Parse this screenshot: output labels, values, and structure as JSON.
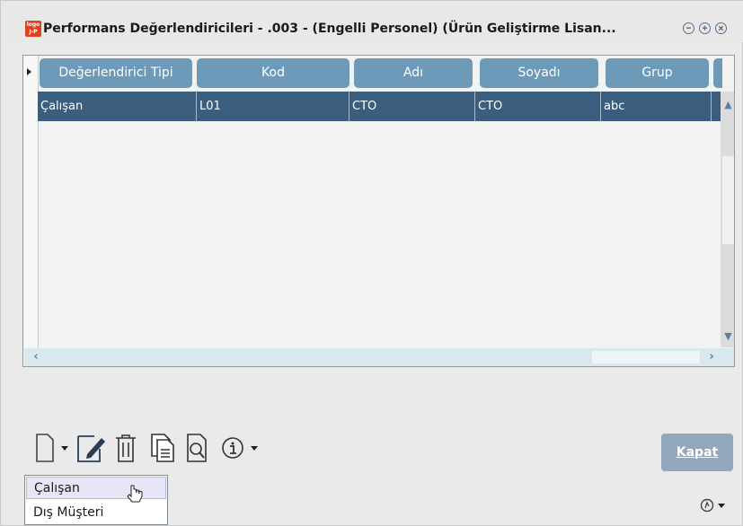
{
  "window": {
    "title": "Performans Değerlendiricileri - .003 - (Engelli Personel) (Ürün Geliştirme Lisan...",
    "logo_text": "J-P",
    "logo_color": "#e0401c"
  },
  "grid": {
    "columns": [
      "Değerlendirici Tipi",
      "Kod",
      "Adı",
      "Soyadı",
      "Grup"
    ],
    "rows": [
      [
        "Çalışan",
        "L01",
        "CTO",
        "CTO",
        "abc"
      ]
    ],
    "header_color": "#6c9ab8",
    "selected_row_color": "#3b5e7e"
  },
  "toolbar": {
    "icons": [
      "new-document-icon",
      "dropdown-arrow-icon",
      "edit-icon",
      "delete-icon",
      "copy-icon",
      "preview-icon",
      "info-icon",
      "dropdown-arrow-icon"
    ],
    "close_label": "Kapat",
    "close_color": "#93a8bc"
  },
  "new_menu": {
    "items": [
      "Çalışan",
      "Dış Müşteri"
    ]
  },
  "footer": {
    "help_icon": "help-icon"
  }
}
